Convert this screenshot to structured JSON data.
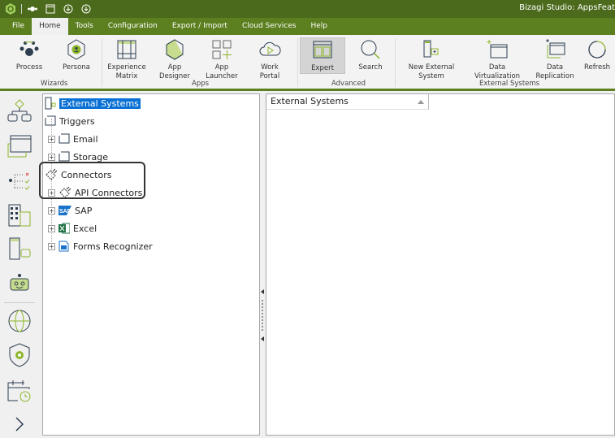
{
  "title": "Bizagi Studio: AppsFeat",
  "tabs": [
    "File",
    "Home",
    "Tools",
    "Configuration",
    "Export / Import",
    "Cloud Services",
    "Help"
  ],
  "active_tab": "Home",
  "ribbon": {
    "wizards": {
      "label": "Wizards",
      "process": "Process",
      "persona": "Persona"
    },
    "apps": {
      "label": "Apps",
      "experience": "Experience",
      "matrix": "Matrix",
      "designer": "App Designer",
      "launcher": "App Launcher",
      "portal": "Work Portal"
    },
    "advanced": {
      "label": "Advanced",
      "expert": "Expert",
      "search": "Search"
    },
    "external": {
      "label": "External Systems",
      "new": "New External System",
      "virt": "Data Virtualization",
      "repl": "Data Replication",
      "refresh": "Refresh"
    }
  },
  "tree": {
    "root": "External Systems",
    "triggers": "Triggers",
    "email": "Email",
    "storage": "Storage",
    "connectors": "Connectors",
    "api": "API Connectors",
    "sap": "SAP",
    "sap_logo": "SAP",
    "excel": "Excel",
    "forms": "Forms Recognizer"
  },
  "list": {
    "column": "External Systems"
  },
  "colors": {
    "titlebar": "#4b6a1c",
    "tabbar": "#5c7f20",
    "accent": "#8db62b",
    "selection": "#0a70d4"
  }
}
